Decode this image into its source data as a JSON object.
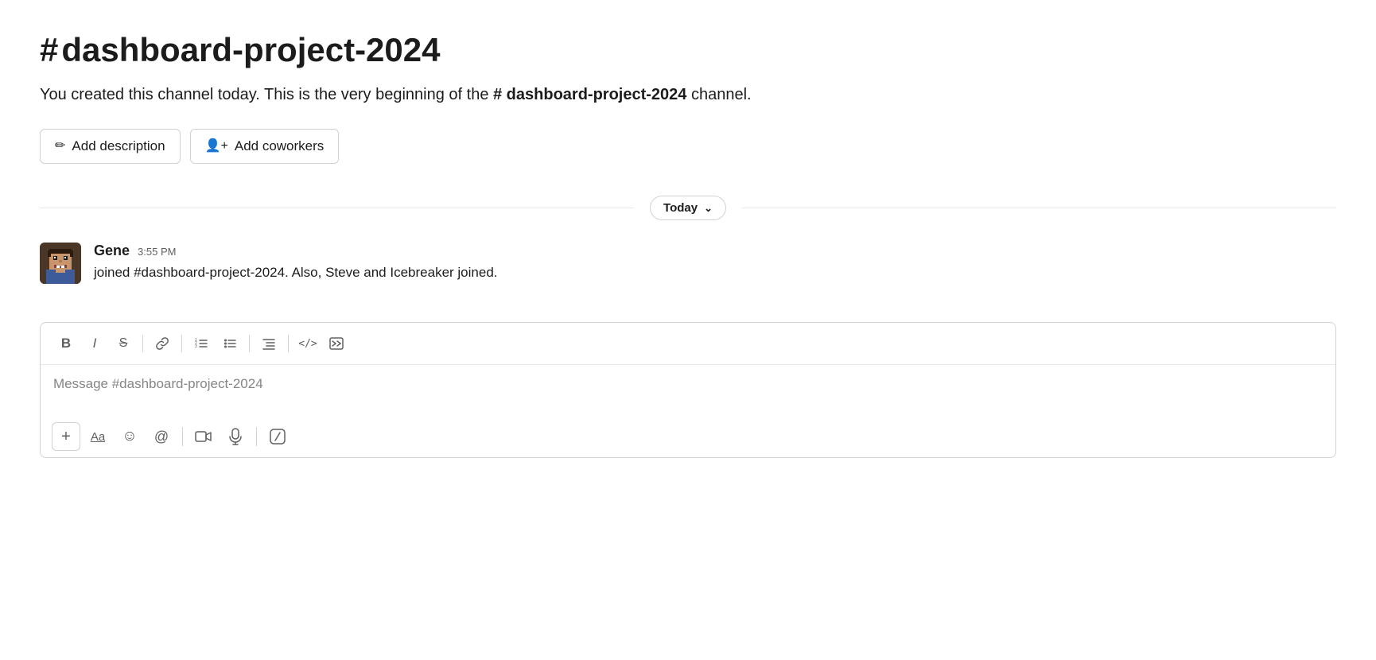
{
  "channel": {
    "name": "dashboard-project-2024",
    "hash_symbol": "#",
    "title": "dashboard-project-2024",
    "description_prefix": "You created this channel today. This is the very beginning of the ",
    "description_channel_ref": "# dashboard-project-2024",
    "description_suffix": " channel.",
    "add_description_label": "Add description",
    "add_coworkers_label": "Add coworkers"
  },
  "divider": {
    "today_label": "Today",
    "chevron": "∨"
  },
  "message": {
    "author": "Gene",
    "time": "3:55 PM",
    "text": "joined #dashboard-project-2024. Also, Steve and Icebreaker joined."
  },
  "compose": {
    "placeholder": "Message #dashboard-project-2024",
    "toolbar": {
      "bold": "B",
      "italic": "I",
      "strikethrough": "S",
      "link": "🔗",
      "ordered_list": "1≡",
      "unordered_list": "≡",
      "indent": "≡",
      "code": "</>",
      "code_block": "⌗"
    },
    "bottom_toolbar": {
      "plus": "+",
      "text_format": "Aa",
      "emoji": "☺",
      "mention": "@",
      "video": "📹",
      "audio": "🎙",
      "slash": "/"
    }
  },
  "icons": {
    "pencil": "✏",
    "add_person": "👤",
    "chevron_down": "⌄"
  }
}
